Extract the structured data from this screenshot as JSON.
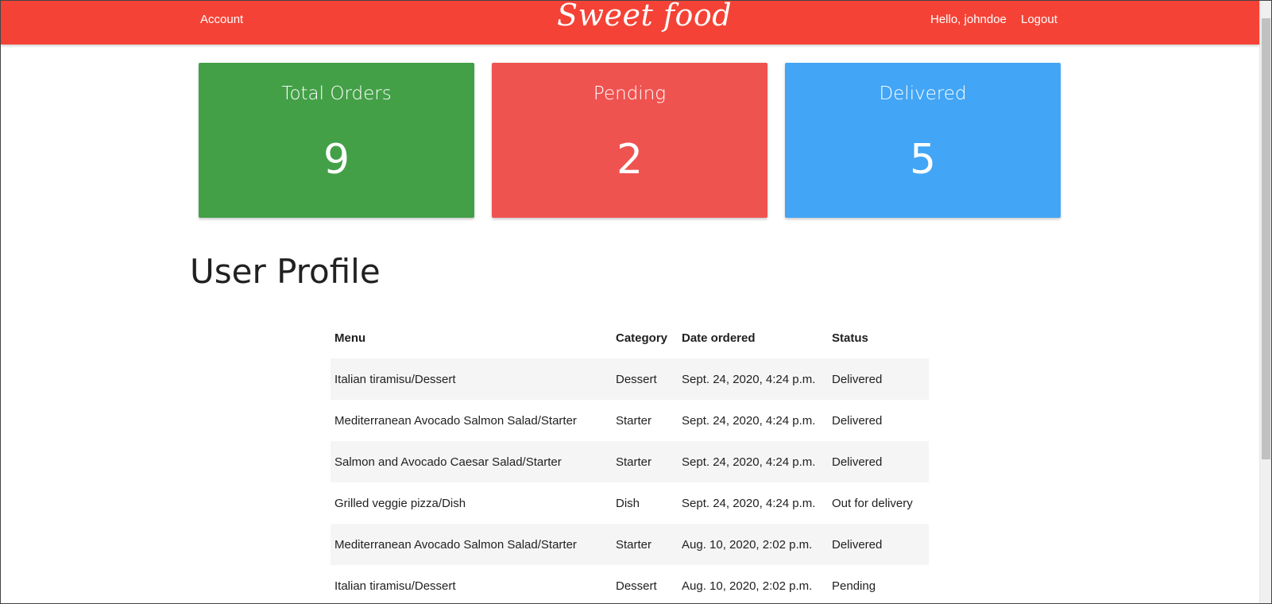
{
  "navbar": {
    "account_label": "Account",
    "brand": "Sweet food",
    "greeting": "Hello, johndoe",
    "logout_label": "Logout",
    "background_color": "#f44336"
  },
  "stats": {
    "total": {
      "label": "Total Orders",
      "value": "9",
      "color": "#43a047"
    },
    "pending": {
      "label": "Pending",
      "value": "2",
      "color": "#ef5350"
    },
    "delivered": {
      "label": "Delivered",
      "value": "5",
      "color": "#42a5f5"
    }
  },
  "page": {
    "title": "User Profile"
  },
  "orders": {
    "columns": [
      "Menu",
      "Category",
      "Date ordered",
      "Status"
    ],
    "rows": [
      [
        "Italian tiramisu/Dessert",
        "Dessert",
        "Sept. 24, 2020, 4:24 p.m.",
        "Delivered"
      ],
      [
        "Mediterranean Avocado Salmon Salad/Starter",
        "Starter",
        "Sept. 24, 2020, 4:24 p.m.",
        "Delivered"
      ],
      [
        "Salmon and Avocado Caesar Salad/Starter",
        "Starter",
        "Sept. 24, 2020, 4:24 p.m.",
        "Delivered"
      ],
      [
        "Grilled veggie pizza/Dish",
        "Dish",
        "Sept. 24, 2020, 4:24 p.m.",
        "Out for delivery"
      ],
      [
        "Mediterranean Avocado Salmon Salad/Starter",
        "Starter",
        "Aug. 10, 2020, 2:02 p.m.",
        "Delivered"
      ],
      [
        "Italian tiramisu/Dessert",
        "Dessert",
        "Aug. 10, 2020, 2:02 p.m.",
        "Pending"
      ]
    ]
  }
}
